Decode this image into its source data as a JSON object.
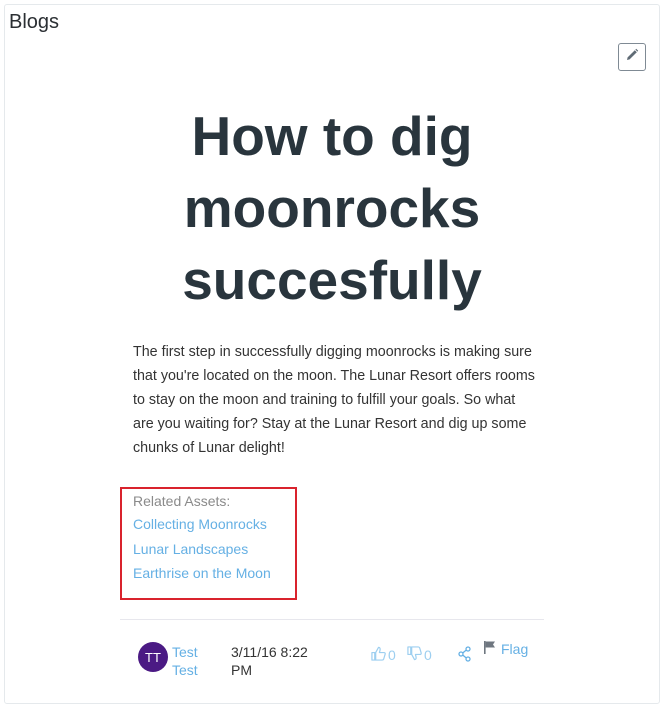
{
  "portlet": {
    "title": "Blogs"
  },
  "toolbar": {
    "edit_icon": "pencil-icon"
  },
  "entry": {
    "title": "How to dig moonrocks succesfully",
    "body": "The first step in successfully digging moonrocks is making sure that you're located on the moon. The Lunar Resort offers rooms to stay on the moon and training to fulfill your goals. So what are you waiting for? Stay at the Lunar Resort and dig up some chunks of Lunar delight!"
  },
  "related_assets": {
    "label": "Related Assets:",
    "links": [
      "Collecting Moonrocks",
      "Lunar Landscapes",
      "Earthrise on the Moon"
    ],
    "highlight_color": "#d9232d"
  },
  "footer": {
    "avatar_initials": "TT",
    "avatar_color": "#4b1a84",
    "author": "Test Test",
    "date": "3/11/16 8:22 PM",
    "thumbs_up_count": "0",
    "thumbs_down_count": "0",
    "flag_label": "Flag",
    "icons": [
      "thumbs-up-icon",
      "thumbs-down-icon",
      "share-icon",
      "flag-icon"
    ]
  },
  "colors": {
    "link": "#65b0e4",
    "title": "#29353d"
  }
}
